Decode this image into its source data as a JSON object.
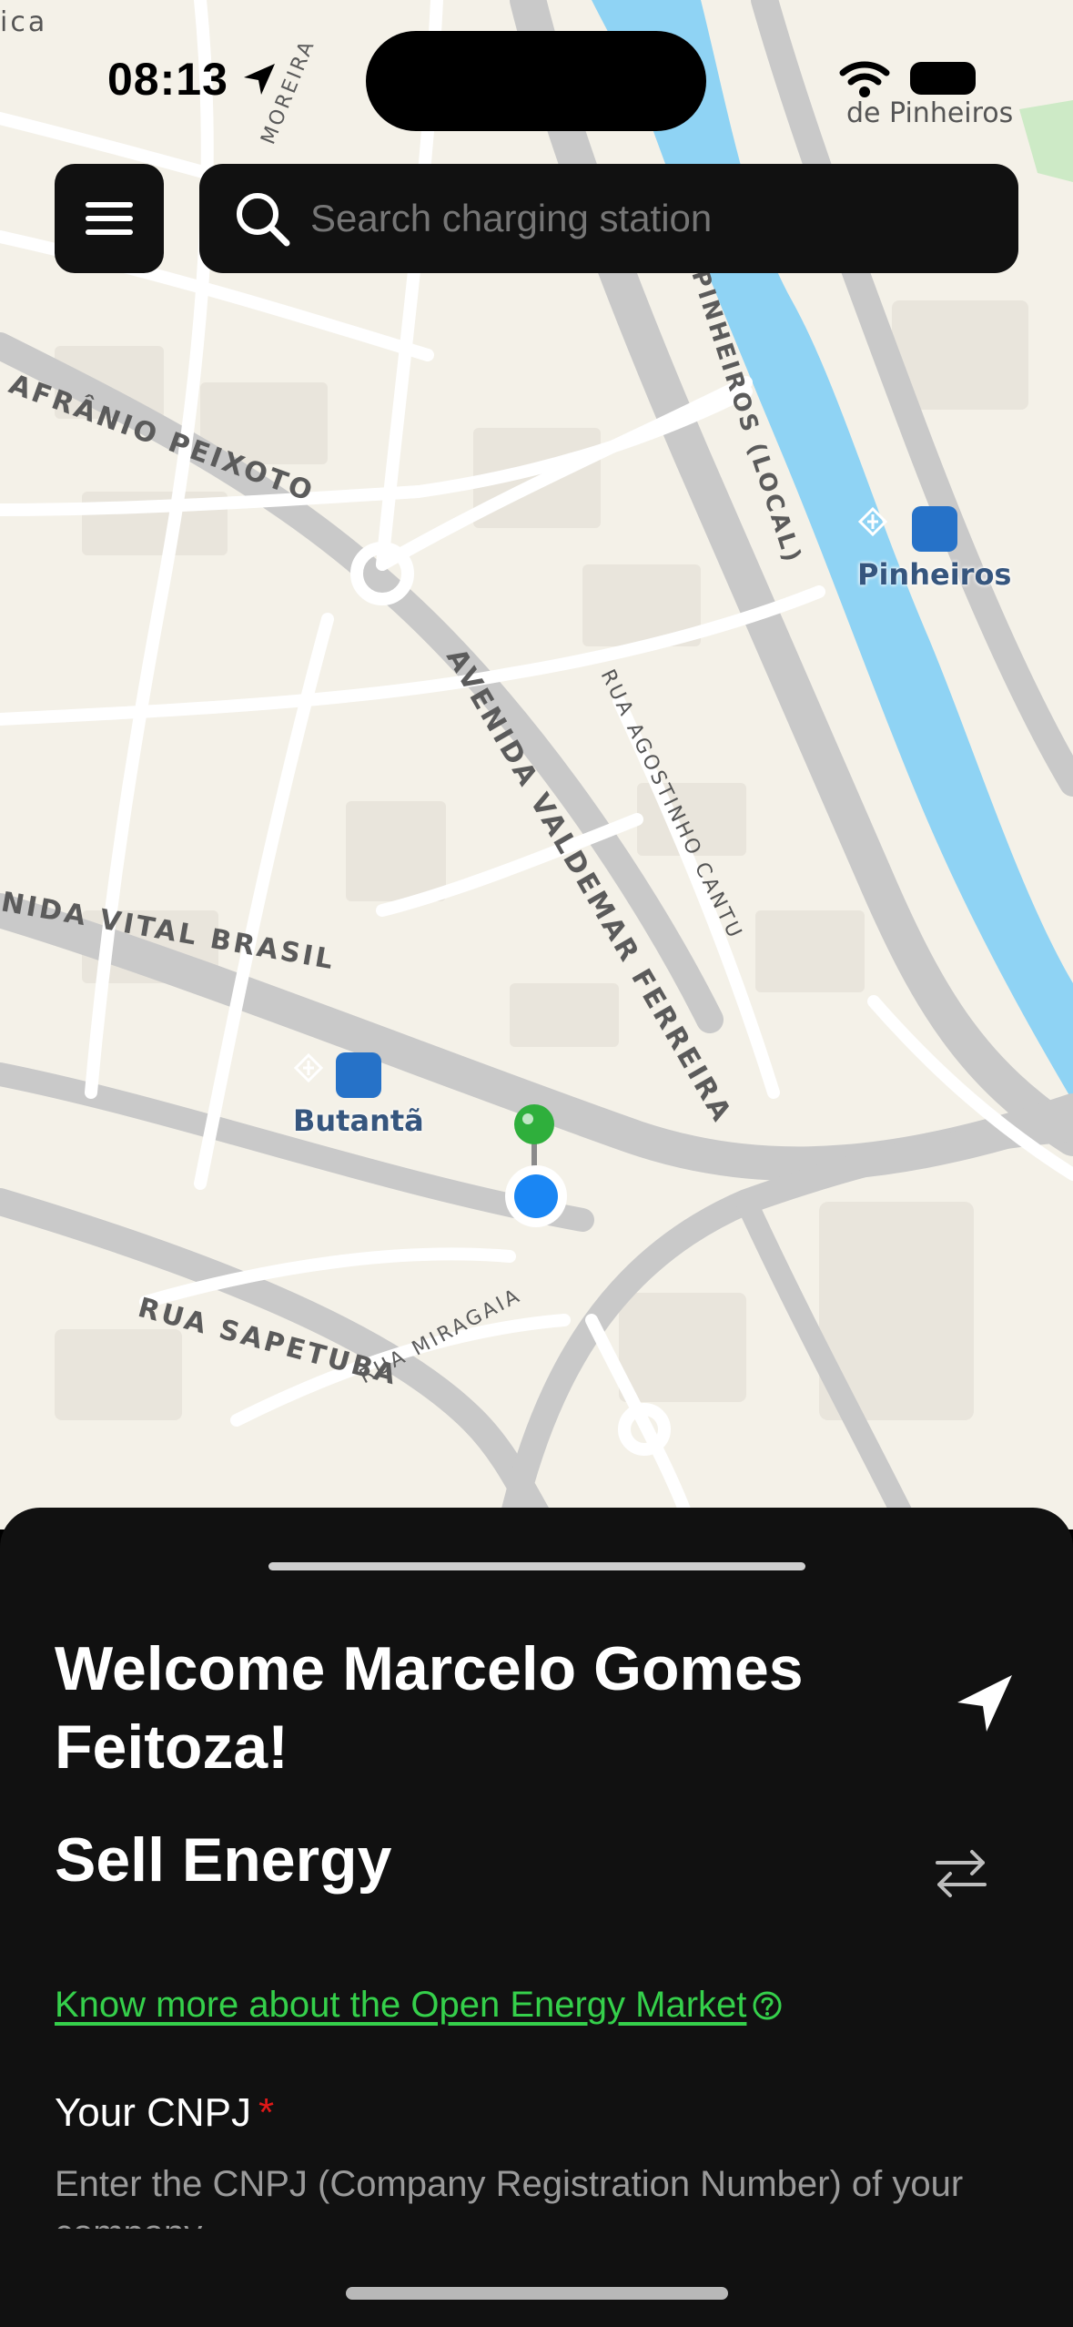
{
  "status": {
    "time": "08:13"
  },
  "search": {
    "placeholder": "Search charging station"
  },
  "map": {
    "streets": [
      "AFRÂNIO PEIXOTO",
      "PINHEIROS (LOCAL)",
      "AVENIDA VALDEMAR FERREIRA",
      "RUA AGOSTINHO CANTU",
      "NIDA VITAL BRASIL",
      "RUA SAPETUBA",
      "RUA MIRAGAIA",
      "MOREIRA",
      "ica",
      "de Pinheiros"
    ],
    "stations": {
      "pinheiros": "Pinheiros",
      "butanta": "Butantã"
    }
  },
  "sheet": {
    "welcome": "Welcome Marcelo Gomes Feitoza!",
    "title": "Sell Energy",
    "market_link": "Know more about the Open Energy Market",
    "cnpj_label": "Your CNPJ",
    "required_mark": "*",
    "cnpj_placeholder": "Enter the CNPJ (Company Registration Number) of your company"
  },
  "colors": {
    "accent": "#35d04b",
    "river": "#8fd3f4",
    "pin": "#3a9fe0"
  },
  "icons": [
    "location-arrow-icon",
    "wifi-icon",
    "battery-icon",
    "menu-icon",
    "search-icon",
    "navigation-arrow-icon",
    "swap-icon",
    "help-circle-icon",
    "user-location-icon",
    "charging-pin-icon",
    "metro-icon"
  ]
}
